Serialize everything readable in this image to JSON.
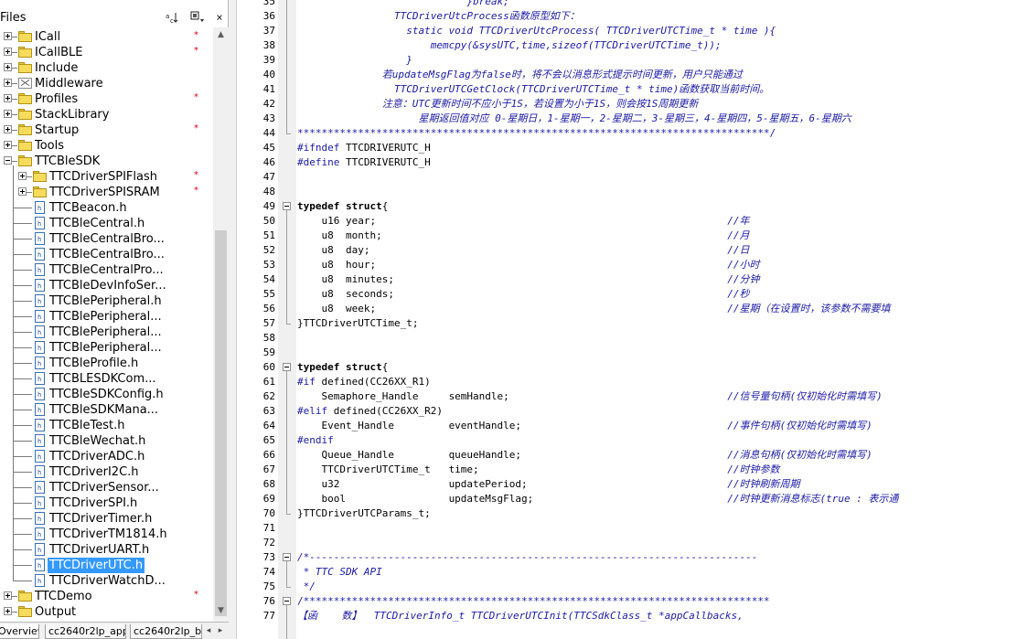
{
  "panel": {
    "title": "Files",
    "header_icon_1": "sort-icon",
    "header_icon_2": "options-icon"
  },
  "tree": [
    {
      "label": "ICall",
      "type": "folder",
      "level": 0,
      "expander": "+",
      "star": true
    },
    {
      "label": "ICallBLE",
      "type": "folder",
      "level": 0,
      "expander": "+",
      "star": true
    },
    {
      "label": "Include",
      "type": "folder",
      "level": 0,
      "expander": "+",
      "star": false
    },
    {
      "label": "Middleware",
      "type": "middleware",
      "level": 0,
      "expander": "+",
      "star": false
    },
    {
      "label": "Profiles",
      "type": "folder",
      "level": 0,
      "expander": "+",
      "star": true
    },
    {
      "label": "StackLibrary",
      "type": "folder",
      "level": 0,
      "expander": "+",
      "star": false
    },
    {
      "label": "Startup",
      "type": "folder",
      "level": 0,
      "expander": "+",
      "star": true
    },
    {
      "label": "Tools",
      "type": "folder",
      "level": 0,
      "expander": "+",
      "star": false
    },
    {
      "label": "TTCBleSDK",
      "type": "folder",
      "level": 0,
      "expander": "-",
      "star": false
    },
    {
      "label": "TTCDriverSPIFlash",
      "type": "folder",
      "level": 1,
      "expander": "+",
      "star": true
    },
    {
      "label": "TTCDriverSPISRAM",
      "type": "folder",
      "level": 1,
      "expander": "+",
      "star": true
    },
    {
      "label": "TTCBeacon.h",
      "type": "file",
      "level": 1,
      "star": false
    },
    {
      "label": "TTCBleCentral.h",
      "type": "file",
      "level": 1,
      "star": false
    },
    {
      "label": "TTCBleCentralBro...",
      "type": "file",
      "level": 1,
      "star": false
    },
    {
      "label": "TTCBleCentralBro...",
      "type": "file",
      "level": 1,
      "star": false
    },
    {
      "label": "TTCBleCentralPro...",
      "type": "file",
      "level": 1,
      "star": false
    },
    {
      "label": "TTCBleDevInfoSer...",
      "type": "file",
      "level": 1,
      "star": false
    },
    {
      "label": "TTCBlePeripheral.h",
      "type": "file",
      "level": 1,
      "star": false
    },
    {
      "label": "TTCBlePeripheral...",
      "type": "file",
      "level": 1,
      "star": false
    },
    {
      "label": "TTCBlePeripheral...",
      "type": "file",
      "level": 1,
      "star": false
    },
    {
      "label": "TTCBlePeripheral...",
      "type": "file",
      "level": 1,
      "star": false
    },
    {
      "label": "TTCBleProfile.h",
      "type": "file",
      "level": 1,
      "star": false
    },
    {
      "label": "TTCBLESDKCom...",
      "type": "file",
      "level": 1,
      "star": false
    },
    {
      "label": "TTCBleSDKConfig.h",
      "type": "file",
      "level": 1,
      "star": false
    },
    {
      "label": "TTCBleSDKMana...",
      "type": "file",
      "level": 1,
      "star": false
    },
    {
      "label": "TTCBleTest.h",
      "type": "file",
      "level": 1,
      "star": false
    },
    {
      "label": "TTCBleWechat.h",
      "type": "file",
      "level": 1,
      "star": false
    },
    {
      "label": "TTCDriverADC.h",
      "type": "file",
      "level": 1,
      "star": false
    },
    {
      "label": "TTCDriverI2C.h",
      "type": "file",
      "level": 1,
      "star": false
    },
    {
      "label": "TTCDriverSensor...",
      "type": "file",
      "level": 1,
      "star": false
    },
    {
      "label": "TTCDriverSPI.h",
      "type": "file",
      "level": 1,
      "star": false
    },
    {
      "label": "TTCDriverTimer.h",
      "type": "file",
      "level": 1,
      "star": false
    },
    {
      "label": "TTCDriverTM1814.h",
      "type": "file",
      "level": 1,
      "star": false
    },
    {
      "label": "TTCDriverUART.h",
      "type": "file",
      "level": 1,
      "star": false
    },
    {
      "label": "TTCDriverUTC.h",
      "type": "file",
      "level": 1,
      "star": false,
      "selected": true
    },
    {
      "label": "TTCDriverWatchD...",
      "type": "file",
      "level": 1,
      "star": false
    },
    {
      "label": "TTCDemo",
      "type": "folder",
      "level": 0,
      "expander": "+",
      "star": true
    },
    {
      "label": "Output",
      "type": "folder",
      "level": 0,
      "expander": "+",
      "star": false
    }
  ],
  "tabs": [
    {
      "label": "Overview",
      "active": true
    },
    {
      "label": "cc2640r2lp_app",
      "active": false
    },
    {
      "label": "cc2640r2lp_bi",
      "active": false
    }
  ],
  "editor": {
    "lines": [
      {
        "n": "35",
        "segments": [
          {
            "t": "                            }break;",
            "c": "c-comment"
          }
        ]
      },
      {
        "n": "36",
        "segments": [
          {
            "t": "                TTCDriverUtcProcess函数原型如下：",
            "c": "c-comment"
          }
        ]
      },
      {
        "n": "37",
        "segments": [
          {
            "t": "                  static void TTCDriverUtcProcess( TTCDriverUTCTime_t * time ){",
            "c": "c-comment"
          }
        ]
      },
      {
        "n": "38",
        "segments": [
          {
            "t": "                      memcpy(&sysUTC,time,sizeof(TTCDriverUTCTime_t));",
            "c": "c-comment"
          }
        ]
      },
      {
        "n": "39",
        "segments": [
          {
            "t": "                  }",
            "c": "c-comment"
          }
        ]
      },
      {
        "n": "40",
        "segments": [
          {
            "t": "              若updateMsgFlag为false时，将不会以消息形式提示时间更新，用户只能通过",
            "c": "c-comment"
          }
        ]
      },
      {
        "n": "41",
        "segments": [
          {
            "t": "                TTCDriverUTCGetClock(TTCDriverUTCTime_t * time)函数获取当前时间。",
            "c": "c-comment"
          }
        ]
      },
      {
        "n": "42",
        "segments": [
          {
            "t": "              注意：UTC更新时间不应小于1S，若设置为小于1S，则会按1S周期更新",
            "c": "c-comment"
          }
        ]
      },
      {
        "n": "43",
        "segments": [
          {
            "t": "                    星期返回值对应 0-星期日，1-星期一，2-星期二，3-星期三，4-星期四，5-星期五，6-星期六",
            "c": "c-comment"
          }
        ]
      },
      {
        "n": "44",
        "segments": [
          {
            "t": "******************************************************************************/",
            "c": "c-stars"
          }
        ]
      },
      {
        "n": "45",
        "segments": [
          {
            "t": "#ifndef",
            "c": "c-pp"
          },
          {
            "t": " TTCDRIVERUTC_H",
            "c": "c-code"
          }
        ]
      },
      {
        "n": "46",
        "segments": [
          {
            "t": "#define",
            "c": "c-pp"
          },
          {
            "t": " TTCDRIVERUTC_H",
            "c": "c-code"
          }
        ]
      },
      {
        "n": "47",
        "segments": []
      },
      {
        "n": "48",
        "segments": []
      },
      {
        "n": "49",
        "segments": [
          {
            "t": "typedef",
            "c": "c-kw"
          },
          {
            "t": " ",
            "c": "c-code"
          },
          {
            "t": "struct",
            "c": "c-kw"
          },
          {
            "t": "{",
            "c": "c-code"
          }
        ]
      },
      {
        "n": "50",
        "segments": [
          {
            "t": "    u16 year;                                                          ",
            "c": "c-code"
          },
          {
            "t": "//年",
            "c": "c-cmt-inline"
          }
        ]
      },
      {
        "n": "51",
        "segments": [
          {
            "t": "    u8  month;                                                         ",
            "c": "c-code"
          },
          {
            "t": "//月",
            "c": "c-cmt-inline"
          }
        ]
      },
      {
        "n": "52",
        "segments": [
          {
            "t": "    u8  day;                                                           ",
            "c": "c-code"
          },
          {
            "t": "//日",
            "c": "c-cmt-inline"
          }
        ]
      },
      {
        "n": "53",
        "segments": [
          {
            "t": "    u8  hour;                                                          ",
            "c": "c-code"
          },
          {
            "t": "//小时",
            "c": "c-cmt-inline"
          }
        ]
      },
      {
        "n": "54",
        "segments": [
          {
            "t": "    u8  minutes;                                                       ",
            "c": "c-code"
          },
          {
            "t": "//分钟",
            "c": "c-cmt-inline"
          }
        ]
      },
      {
        "n": "55",
        "segments": [
          {
            "t": "    u8  seconds;                                                       ",
            "c": "c-code"
          },
          {
            "t": "//秒",
            "c": "c-cmt-inline"
          }
        ]
      },
      {
        "n": "56",
        "segments": [
          {
            "t": "    u8  week;                                                          ",
            "c": "c-code"
          },
          {
            "t": "//星期（在设置时，该参数不需要填",
            "c": "c-cmt-inline"
          }
        ]
      },
      {
        "n": "57",
        "segments": [
          {
            "t": "}TTCDriverUTCTime_t;",
            "c": "c-code"
          }
        ]
      },
      {
        "n": "58",
        "segments": []
      },
      {
        "n": "59",
        "segments": []
      },
      {
        "n": "60",
        "segments": [
          {
            "t": "typedef",
            "c": "c-kw"
          },
          {
            "t": " ",
            "c": "c-code"
          },
          {
            "t": "struct",
            "c": "c-kw"
          },
          {
            "t": "{",
            "c": "c-code"
          }
        ]
      },
      {
        "n": "61",
        "segments": [
          {
            "t": "#if",
            "c": "c-pp"
          },
          {
            "t": " defined(CC26XX_R1)",
            "c": "c-code"
          }
        ]
      },
      {
        "n": "62",
        "segments": [
          {
            "t": "    Semaphore_Handle     semHandle;                                    ",
            "c": "c-code"
          },
          {
            "t": "//信号量句柄(仅初始化时需填写)",
            "c": "c-cmt-inline"
          }
        ]
      },
      {
        "n": "63",
        "segments": [
          {
            "t": "#elif",
            "c": "c-pp"
          },
          {
            "t": " defined(CC26XX_R2)",
            "c": "c-code"
          }
        ]
      },
      {
        "n": "64",
        "segments": [
          {
            "t": "    Event_Handle         eventHandle;                                  ",
            "c": "c-code"
          },
          {
            "t": "//事件句柄(仅初始化时需填写)",
            "c": "c-cmt-inline"
          }
        ]
      },
      {
        "n": "65",
        "segments": [
          {
            "t": "#endif",
            "c": "c-pp"
          }
        ]
      },
      {
        "n": "66",
        "segments": [
          {
            "t": "    Queue_Handle         queueHandle;                                  ",
            "c": "c-code"
          },
          {
            "t": "//消息句柄(仅初始化时需填写)",
            "c": "c-cmt-inline"
          }
        ]
      },
      {
        "n": "67",
        "segments": [
          {
            "t": "    TTCDriverUTCTime_t   time;                                         ",
            "c": "c-code"
          },
          {
            "t": "//时钟参数",
            "c": "c-cmt-inline"
          }
        ]
      },
      {
        "n": "68",
        "segments": [
          {
            "t": "    u32                  updatePeriod;                                 ",
            "c": "c-code"
          },
          {
            "t": "//时钟刷新周期",
            "c": "c-cmt-inline"
          }
        ]
      },
      {
        "n": "69",
        "segments": [
          {
            "t": "    bool                 updateMsgFlag;                                ",
            "c": "c-code"
          },
          {
            "t": "//时钟更新消息标志(true : 表示通",
            "c": "c-cmt-inline"
          }
        ]
      },
      {
        "n": "70",
        "segments": [
          {
            "t": "}TTCDriverUTCParams_t;",
            "c": "c-code"
          }
        ]
      },
      {
        "n": "71",
        "segments": []
      },
      {
        "n": "72",
        "segments": []
      },
      {
        "n": "73",
        "segments": [
          {
            "t": "/*--------------------------------------------------------------------------",
            "c": "c-comment"
          }
        ]
      },
      {
        "n": "74",
        "segments": [
          {
            "t": " * TTC SDK API",
            "c": "c-comment"
          }
        ]
      },
      {
        "n": "75",
        "segments": [
          {
            "t": " */",
            "c": "c-comment"
          }
        ]
      },
      {
        "n": "76",
        "segments": [
          {
            "t": "/*****************************************************************************",
            "c": "c-stars"
          }
        ]
      },
      {
        "n": "77",
        "segments": [
          {
            "t": "【函    数】  TTCDriverInfo_t TTCDriverUTCInit(TTCSdkClass_t *appCallbacks,",
            "c": "c-comment"
          }
        ]
      }
    ]
  }
}
